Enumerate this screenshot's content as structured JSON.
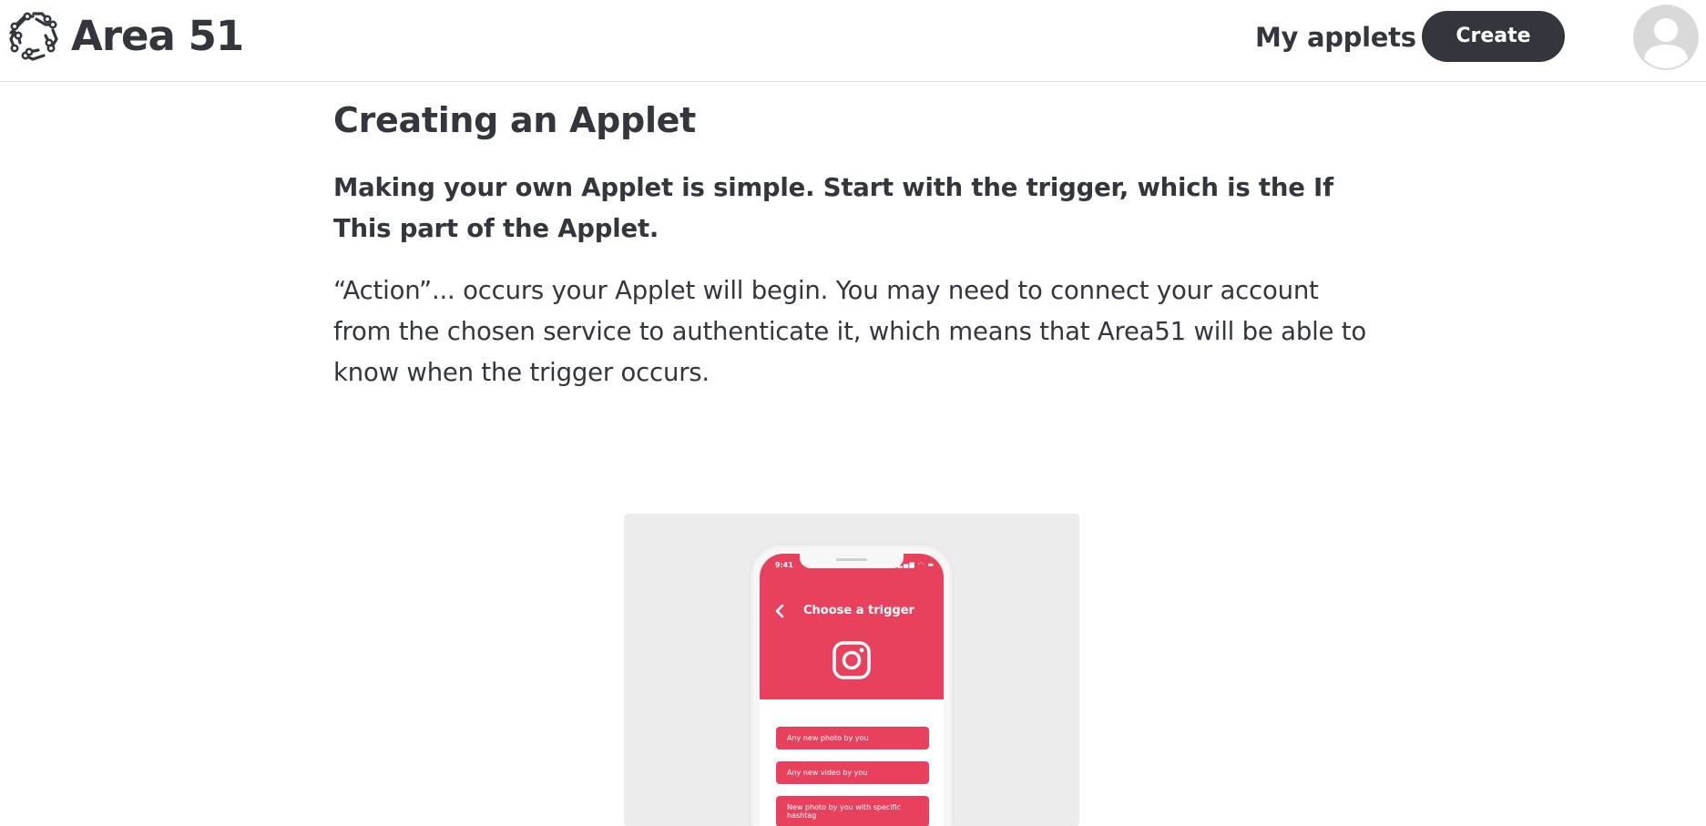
{
  "header": {
    "brand": "Area 51",
    "nav_my_applets": "My applets",
    "create_label": "Create"
  },
  "article": {
    "title": "Creating an Applet",
    "lead": "Making your own Applet is simple. Start with the trigger, which is the If This part of the Applet.",
    "body": "“Action”... occurs your Applet will begin. You may need to connect your account from the chosen service to authenticate it, which means that Area51 will be able to know when the trigger occurs."
  },
  "illustration": {
    "status_time": "9:41",
    "screen_title": "Choose a trigger",
    "options": [
      "Any new photo by you",
      "Any new video by you",
      "New photo by you with specific hashtag"
    ]
  },
  "colors": {
    "dark": "#33363d",
    "accent": "#e8415e",
    "illustration_bg": "#ececec"
  }
}
